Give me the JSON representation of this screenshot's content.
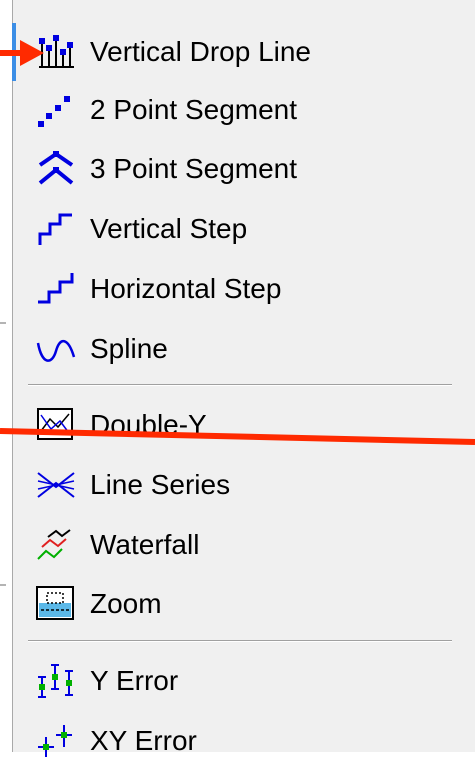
{
  "menu": {
    "items": [
      {
        "label": "Vertical Drop Line",
        "icon": "vertical-drop-line-icon"
      },
      {
        "label": "2 Point Segment",
        "icon": "two-point-segment-icon"
      },
      {
        "label": "3 Point Segment",
        "icon": "three-point-segment-icon"
      },
      {
        "label": "Vertical Step",
        "icon": "vertical-step-icon"
      },
      {
        "label": "Horizontal Step",
        "icon": "horizontal-step-icon"
      },
      {
        "label": "Spline",
        "icon": "spline-icon"
      },
      {
        "label": "Double-Y",
        "icon": "double-y-icon"
      },
      {
        "label": "Line Series",
        "icon": "line-series-icon"
      },
      {
        "label": "Waterfall",
        "icon": "waterfall-icon"
      },
      {
        "label": "Zoom",
        "icon": "zoom-icon"
      },
      {
        "label": "Y Error",
        "icon": "y-error-icon"
      },
      {
        "label": "XY Error",
        "icon": "xy-error-icon"
      }
    ]
  },
  "colors": {
    "menu_background": "#f0f0f0",
    "icon_blue": "#0000e0",
    "selection_marker": "#3c8ee6",
    "annotation_red": "#ff2a00"
  }
}
